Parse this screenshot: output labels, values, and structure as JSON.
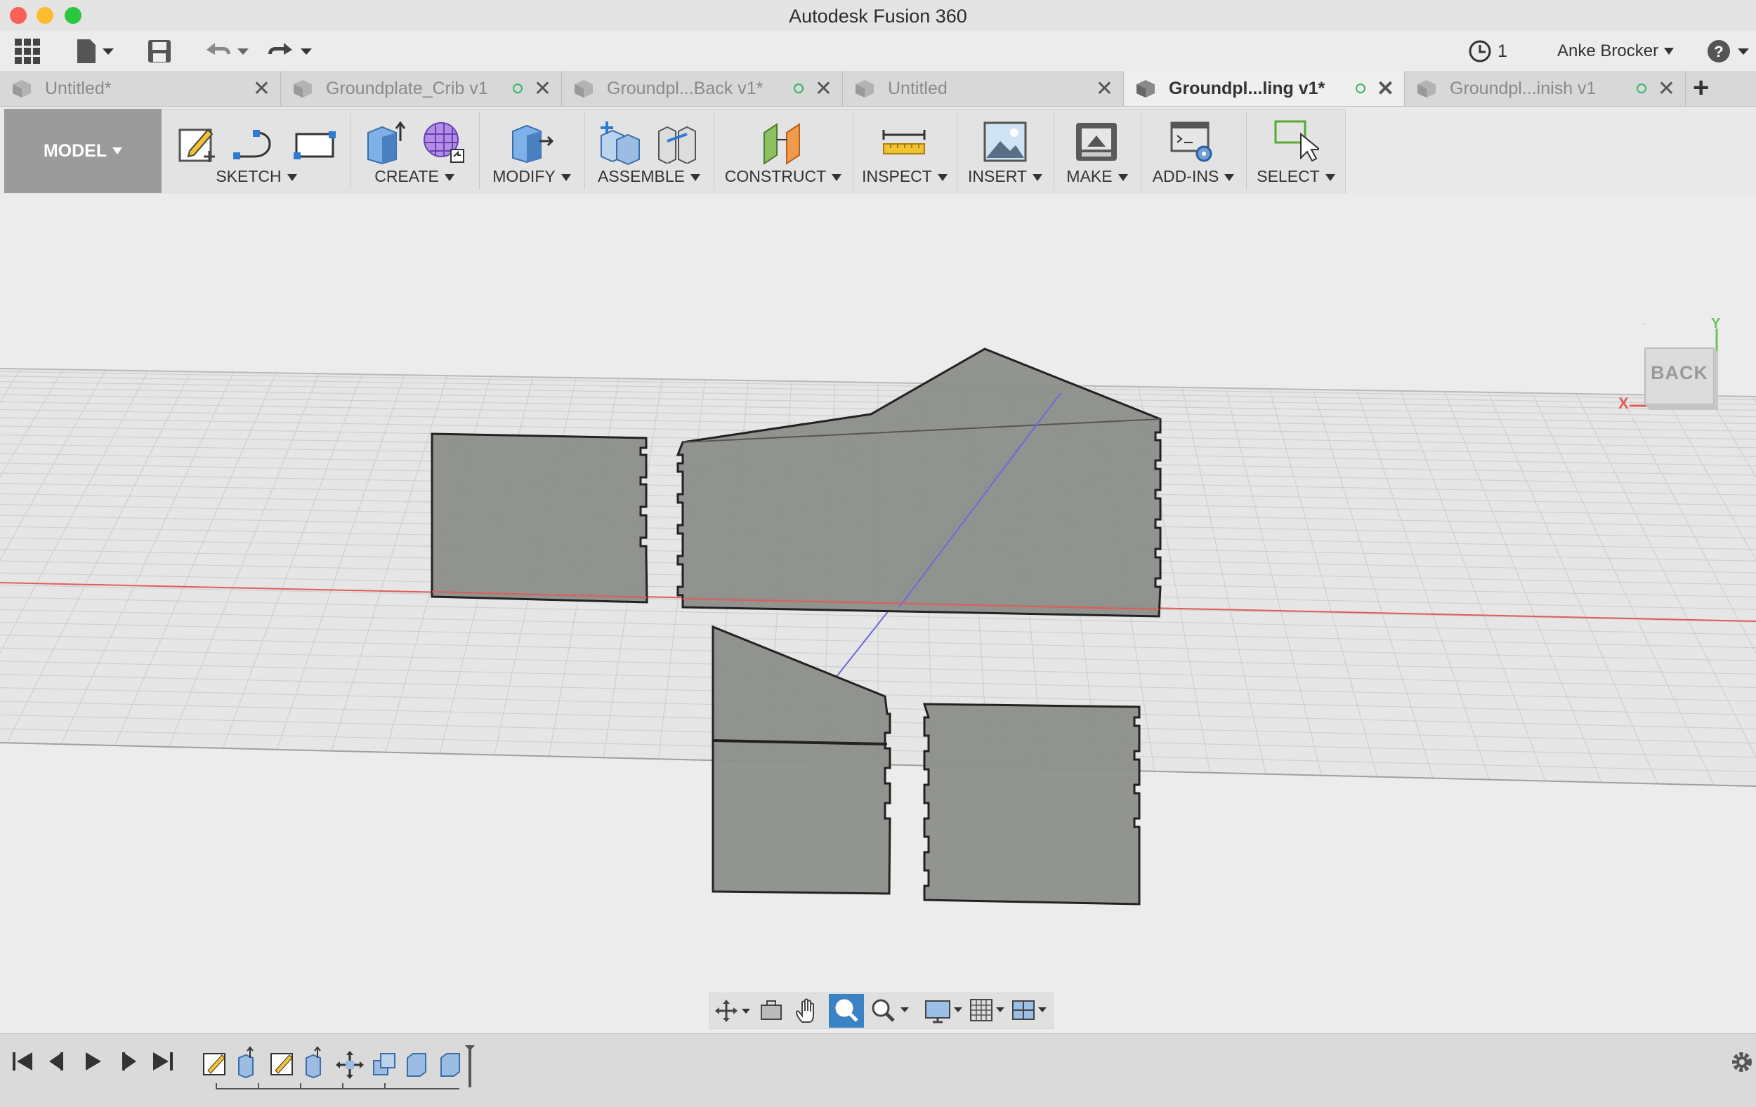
{
  "window": {
    "title": "Autodesk Fusion 360"
  },
  "quickbar": {
    "jobs_count": "1",
    "user_name": "Anke Brocker"
  },
  "tabs": [
    {
      "label": "Untitled*",
      "active": false,
      "saved_dot": false
    },
    {
      "label": "Groundplate_Crib v1",
      "active": false,
      "saved_dot": true
    },
    {
      "label": "Groundpl...Back v1*",
      "active": false,
      "saved_dot": true
    },
    {
      "label": "Untitled",
      "active": false,
      "saved_dot": false
    },
    {
      "label": "Groundpl...ling v1*",
      "active": true,
      "saved_dot": true
    },
    {
      "label": "Groundpl...inish v1",
      "active": false,
      "saved_dot": true
    }
  ],
  "ribbon": {
    "workspace": "MODEL",
    "groups": [
      "SKETCH",
      "CREATE",
      "MODIFY",
      "ASSEMBLE",
      "CONSTRUCT",
      "INSPECT",
      "INSERT",
      "MAKE",
      "ADD-INS",
      "SELECT"
    ]
  },
  "viewcube": {
    "face": "BACK",
    "axis_x": "X",
    "axis_y": "Y"
  },
  "colors": {
    "accent_active": "#3b82c4",
    "body_fill": "#8e908b",
    "axis_red": "#e25b5b",
    "axis_blue": "#6a6ae0",
    "saved_green": "#36b56b"
  }
}
